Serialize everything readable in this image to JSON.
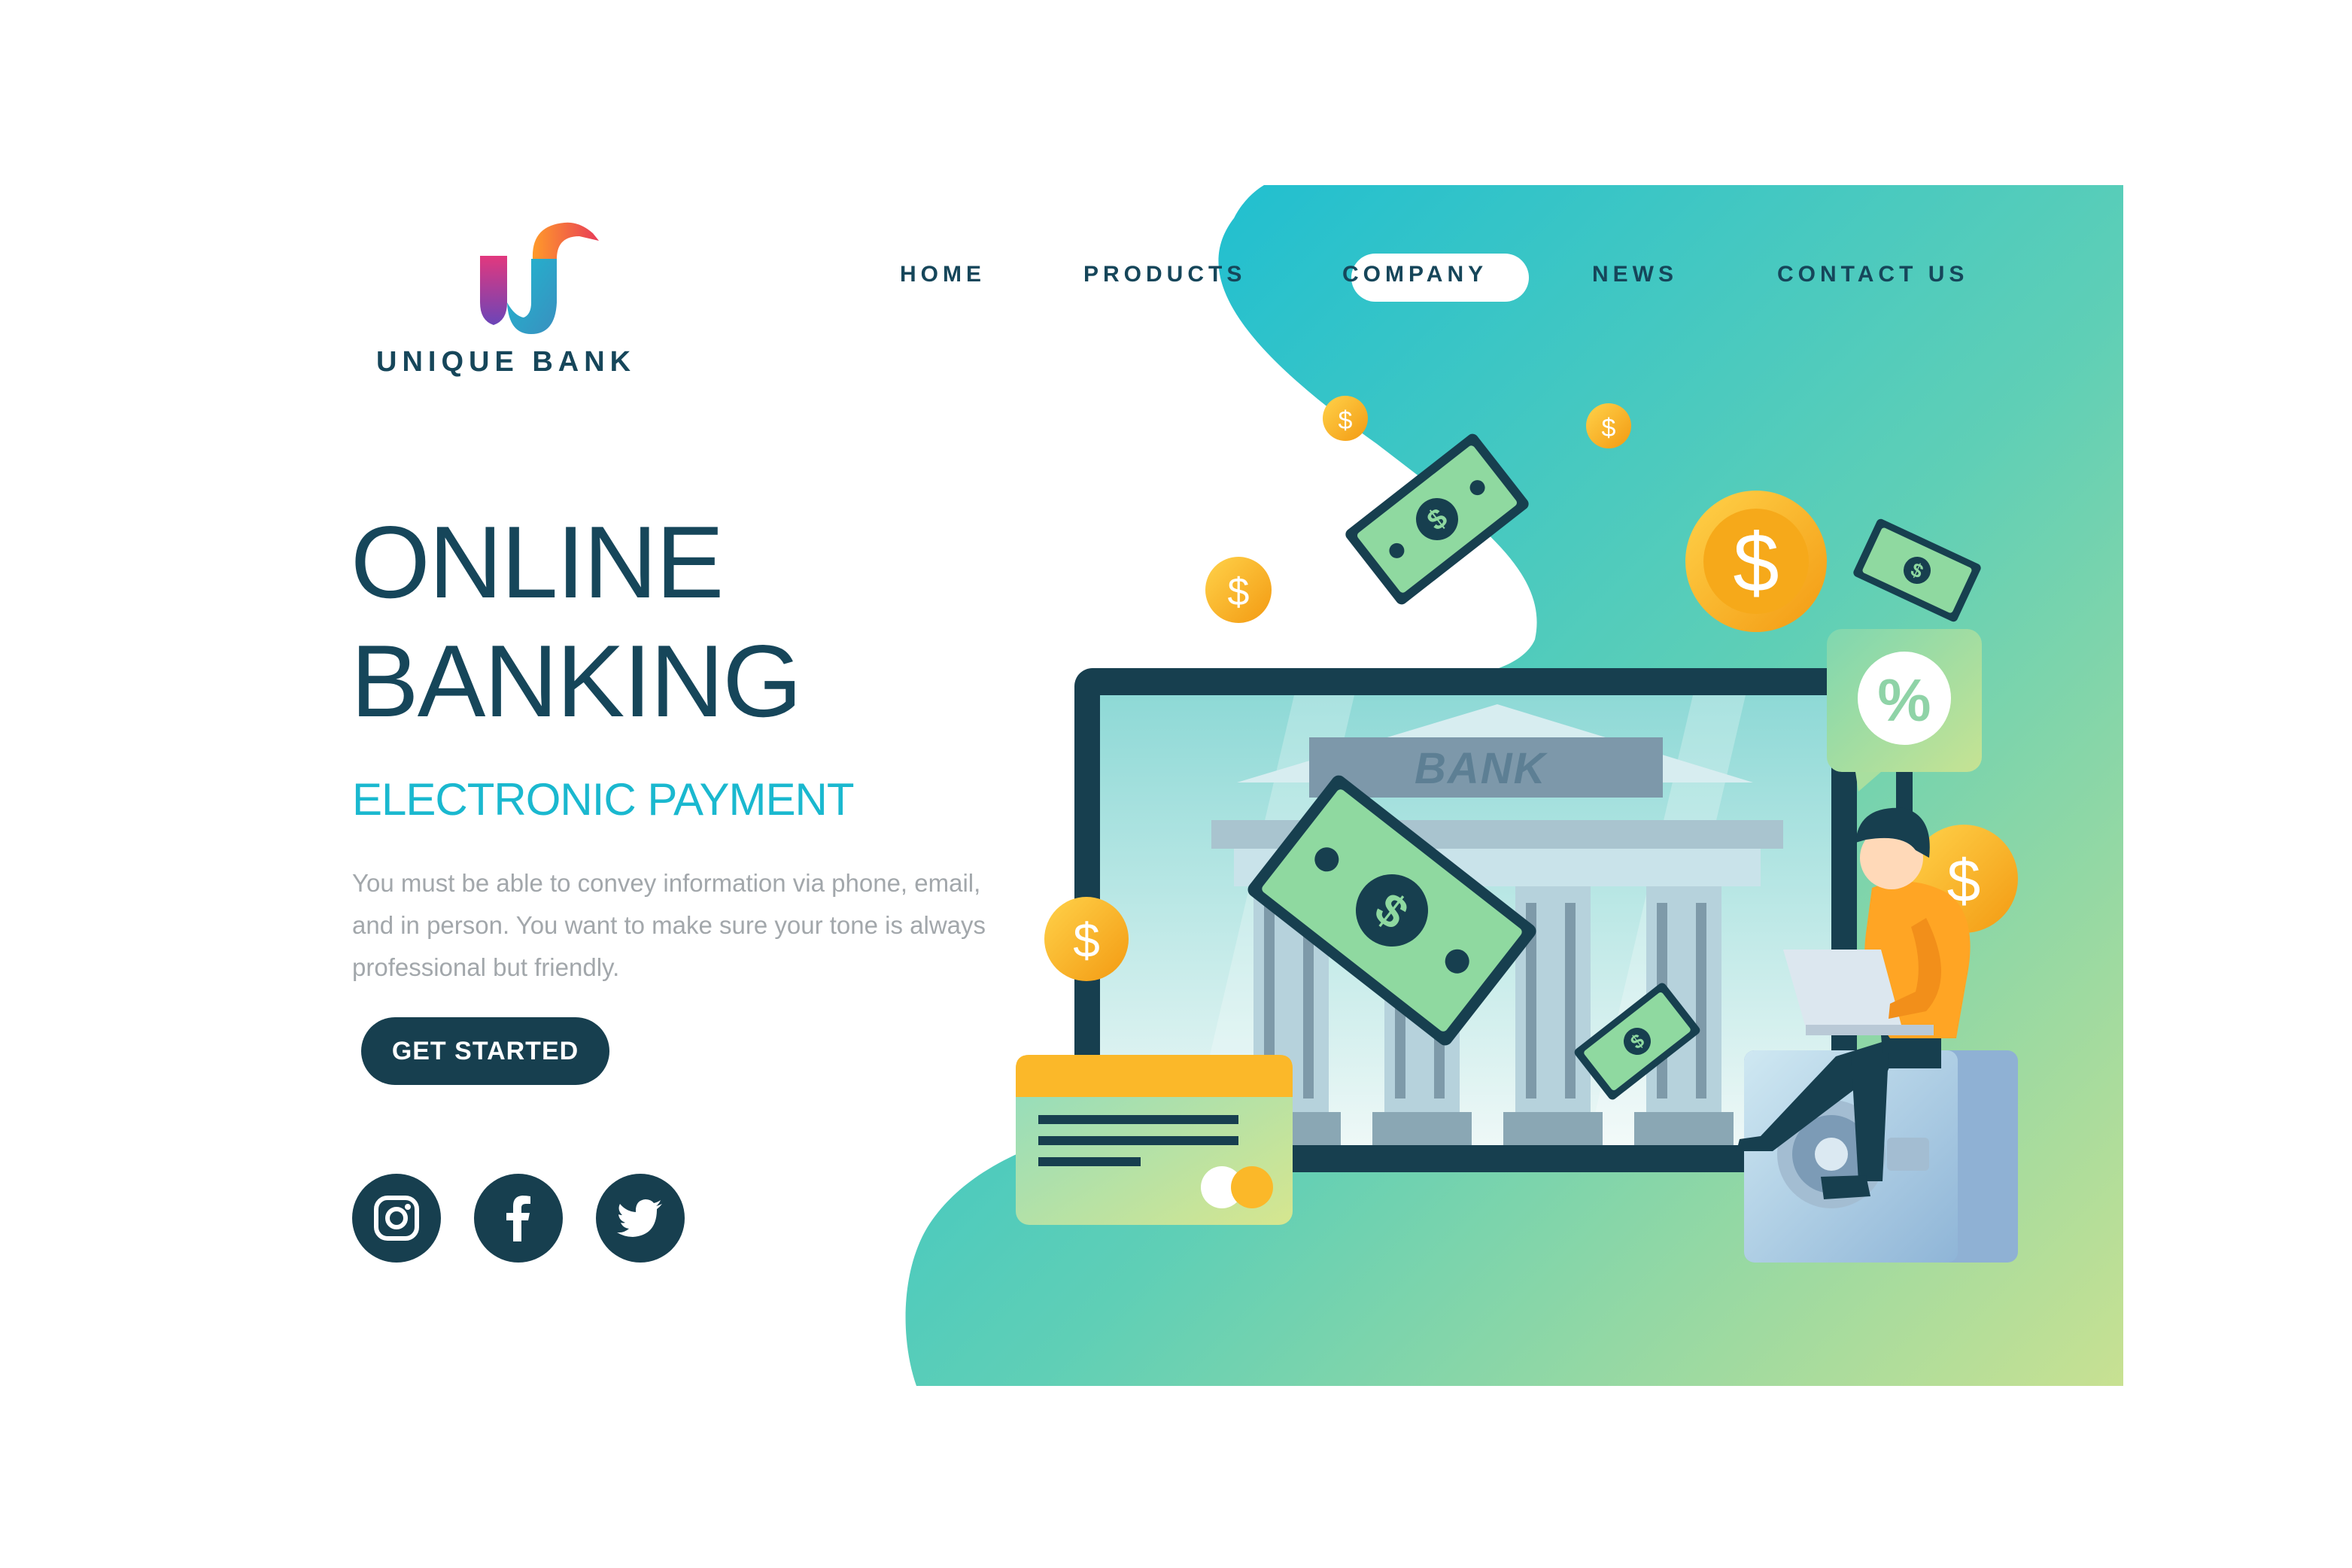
{
  "brand": {
    "name": "UNIQUE BANK"
  },
  "nav": {
    "items": [
      "HOME",
      "PRODUCTS",
      "COMPANY",
      "NEWS",
      "CONTACT US"
    ],
    "active": "COMPANY"
  },
  "hero": {
    "title_line1": "ONLINE",
    "title_line2": "BANKING",
    "subtitle": "ELECTRONIC PAYMENT",
    "description": "You must be able to convey information via phone, email, and in person. You want to make sure your tone is always professional but friendly.",
    "cta_label": "GET STARTED"
  },
  "social": {
    "icons": [
      "instagram-icon",
      "facebook-icon",
      "twitter-icon"
    ]
  },
  "illustration": {
    "bank_sign": "BANK",
    "percent_badge": "%",
    "coin_symbol": "$"
  },
  "colors": {
    "navy": "#16465a",
    "accent_cyan": "#1ab8cf",
    "gradient_start": "#12bcd6",
    "gradient_end": "#c6e092",
    "coin": "#f9b418",
    "money": "#8fd9a0"
  }
}
